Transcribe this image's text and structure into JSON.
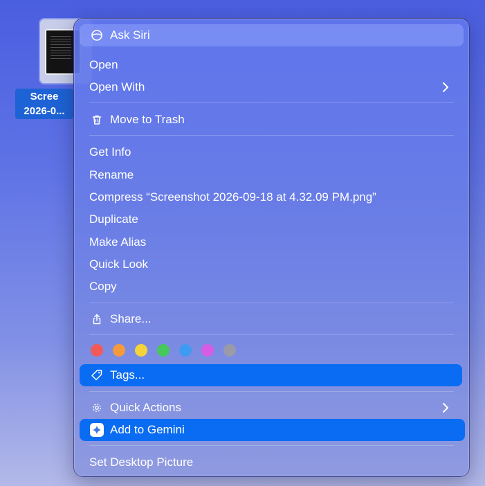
{
  "desktop": {
    "file": {
      "label_line1": "Scree",
      "label_line2": "2026-0..."
    }
  },
  "menu": {
    "ask_siri": "Ask Siri",
    "open": "Open",
    "open_with": "Open With",
    "move_to_trash": "Move to Trash",
    "get_info": "Get Info",
    "rename": "Rename",
    "compress": "Compress “Screenshot 2026-09-18 at 4.32.09 PM.png”",
    "duplicate": "Duplicate",
    "make_alias": "Make Alias",
    "quick_look": "Quick Look",
    "copy": "Copy",
    "share": "Share...",
    "tags": "Tags...",
    "quick_actions": "Quick Actions",
    "add_to_gemini": "Add to Gemini",
    "set_desktop_picture": "Set Desktop Picture"
  },
  "tag_colors": [
    "#f25a5a",
    "#f59a3c",
    "#f5d43a",
    "#46c85a",
    "#3f9af2",
    "#d65ce6",
    "#9a9aa8"
  ],
  "colors": {
    "highlight": "#0a6cf2",
    "file_label_bg": "#1d63d6"
  }
}
